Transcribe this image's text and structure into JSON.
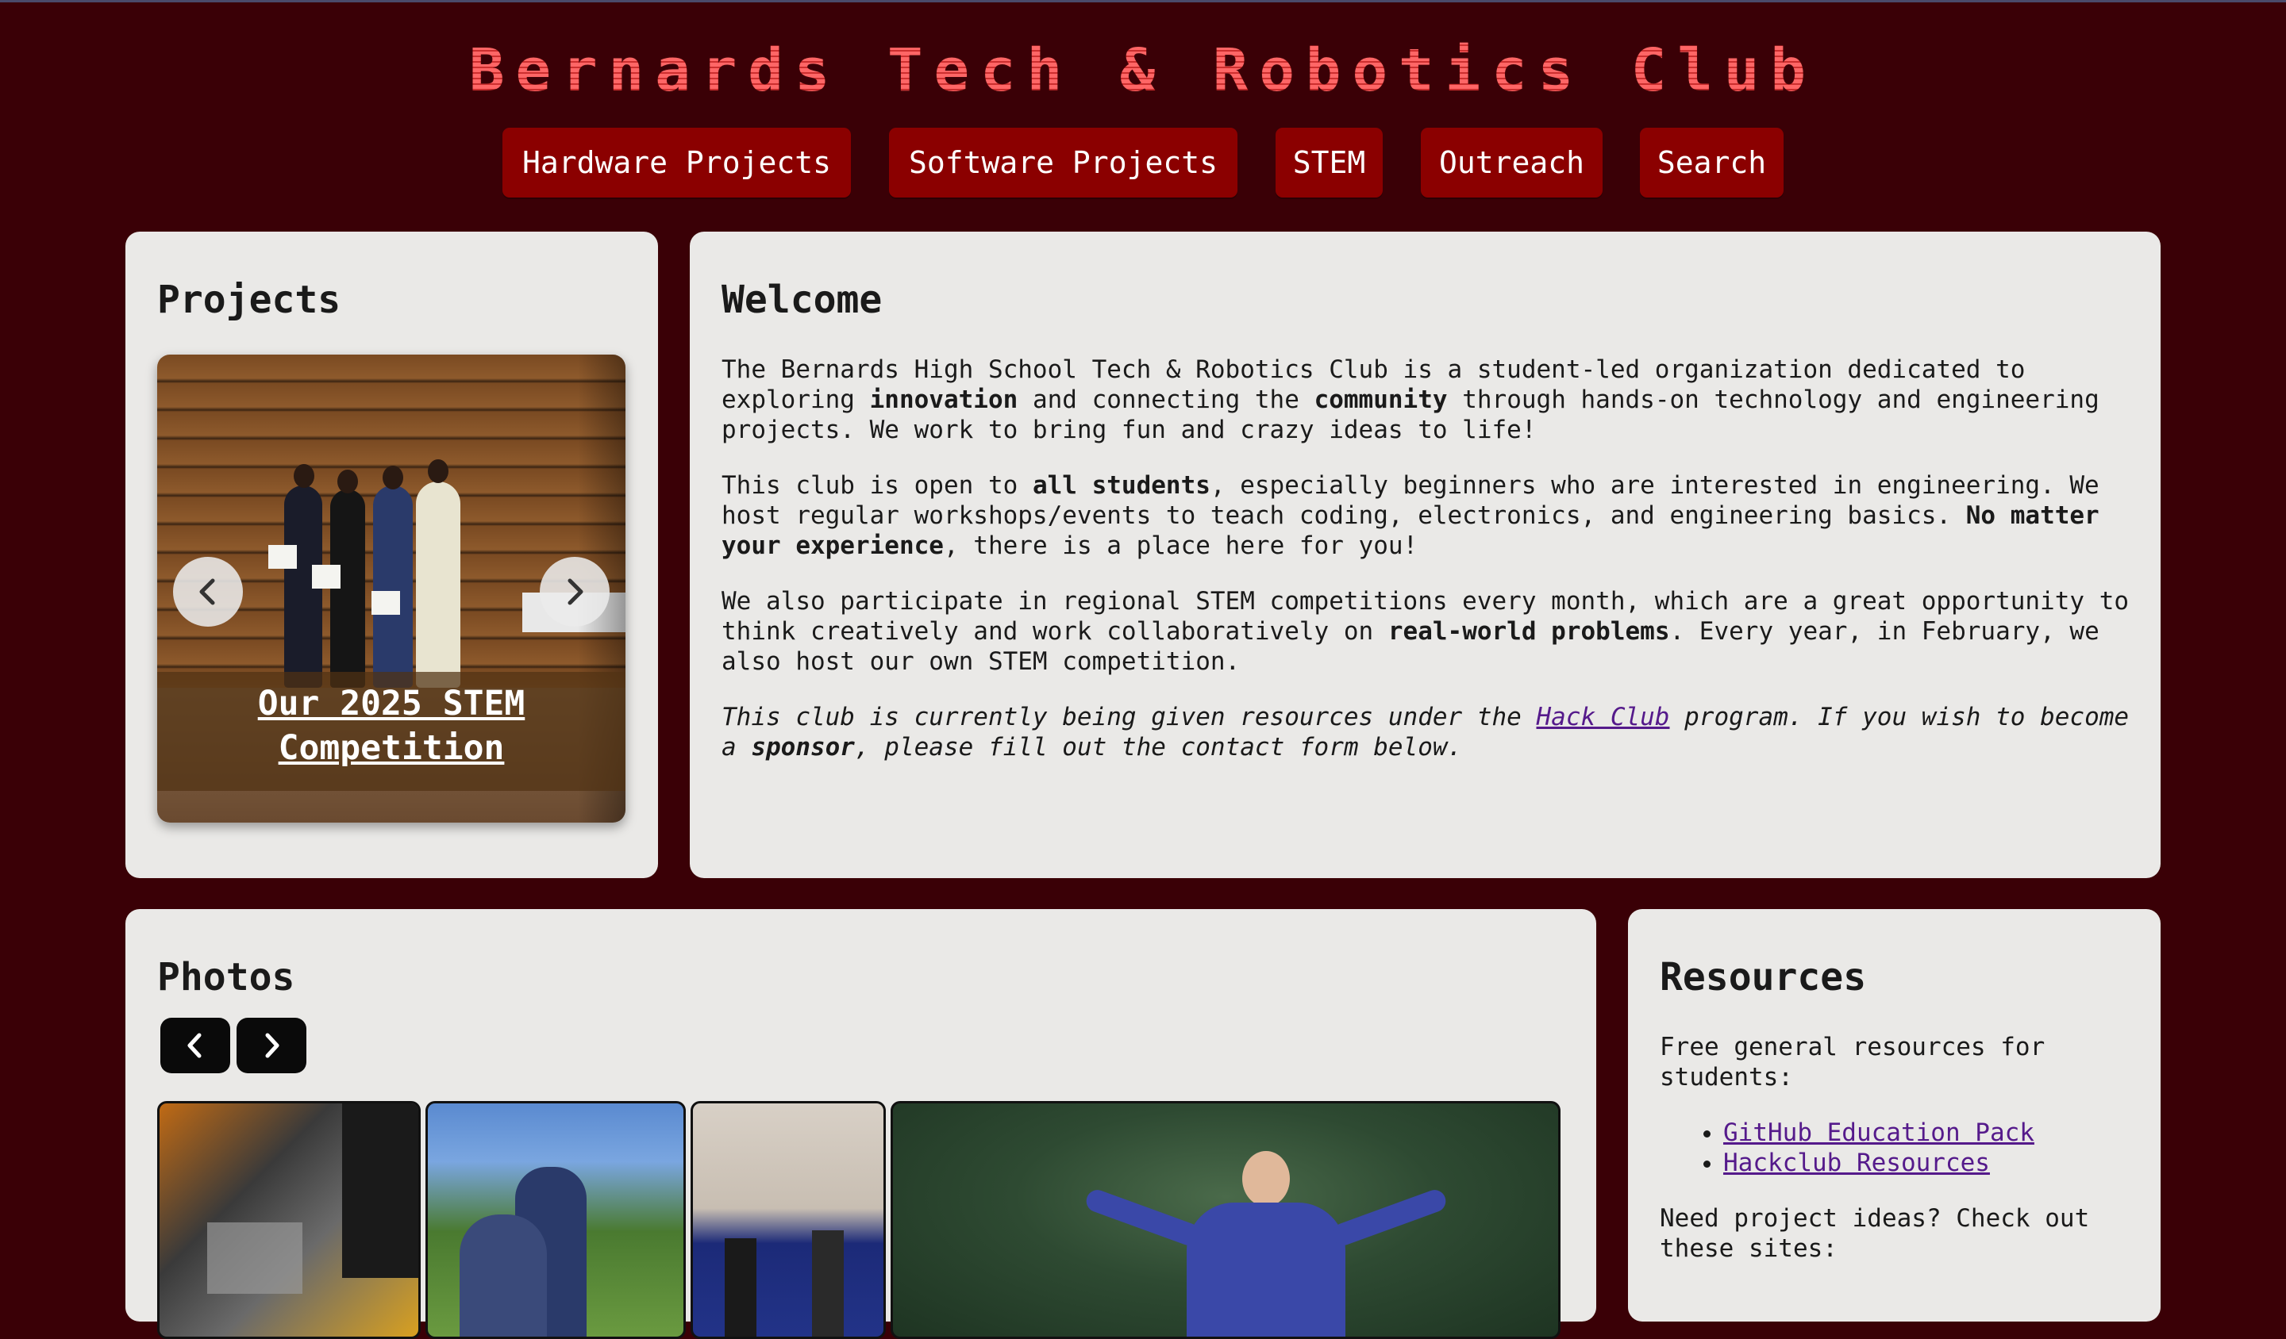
{
  "header": {
    "title": "Bernards Tech & Robotics Club"
  },
  "nav": {
    "items": [
      {
        "label": "Hardware Projects"
      },
      {
        "label": "Software Projects"
      },
      {
        "label": "STEM"
      },
      {
        "label": "Outreach"
      },
      {
        "label": "Search"
      }
    ]
  },
  "projects": {
    "heading": "Projects",
    "carousel": {
      "slide_caption_line1": "Our 2025 STEM",
      "slide_caption_line2": "Competition",
      "prev_icon": "chevron-left-icon",
      "next_icon": "chevron-right-icon"
    }
  },
  "welcome": {
    "heading": "Welcome",
    "p1": {
      "a": "The Bernards High School Tech & Robotics Club is a student-led organization dedicated to exploring ",
      "b": "innovation",
      "c": " and connecting the ",
      "d": "community",
      "e": " through hands-on technology and engineering projects. We work to bring fun and crazy ideas to life!"
    },
    "p2": {
      "a": "This club is open to ",
      "b": "all students",
      "c": ", especially beginners who are interested in engineering. We host regular workshops/events to teach coding, electronics, and engineering basics. ",
      "d": "No matter your experience",
      "e": ", there is a place here for you!"
    },
    "p3": {
      "a": "We also participate in regional STEM competitions every month, which are a great opportunity to think creatively and work collaboratively on ",
      "b": "real-world problems",
      "c": ". Every year, in February, we also host our own STEM competition."
    },
    "p4": {
      "a": "This club is currently being given resources under the ",
      "link": "Hack Club",
      "b": " program. If you wish to become a ",
      "c": "sponsor",
      "d": ", please fill out the contact form below."
    }
  },
  "photos": {
    "heading": "Photos",
    "prev_icon": "chevron-left-icon",
    "next_icon": "chevron-right-icon"
  },
  "resources": {
    "heading": "Resources",
    "intro": "Free general resources for students:",
    "links": [
      {
        "label": "GitHub Education Pack"
      },
      {
        "label": "Hackclub Resources"
      }
    ],
    "ideas": "Need project ideas? Check out these sites:"
  },
  "colors": {
    "background": "#3a0006",
    "nav_button": "#8b0000",
    "title": "#ff5a5a",
    "card": "#eae9e7",
    "link": "#551a8b"
  }
}
